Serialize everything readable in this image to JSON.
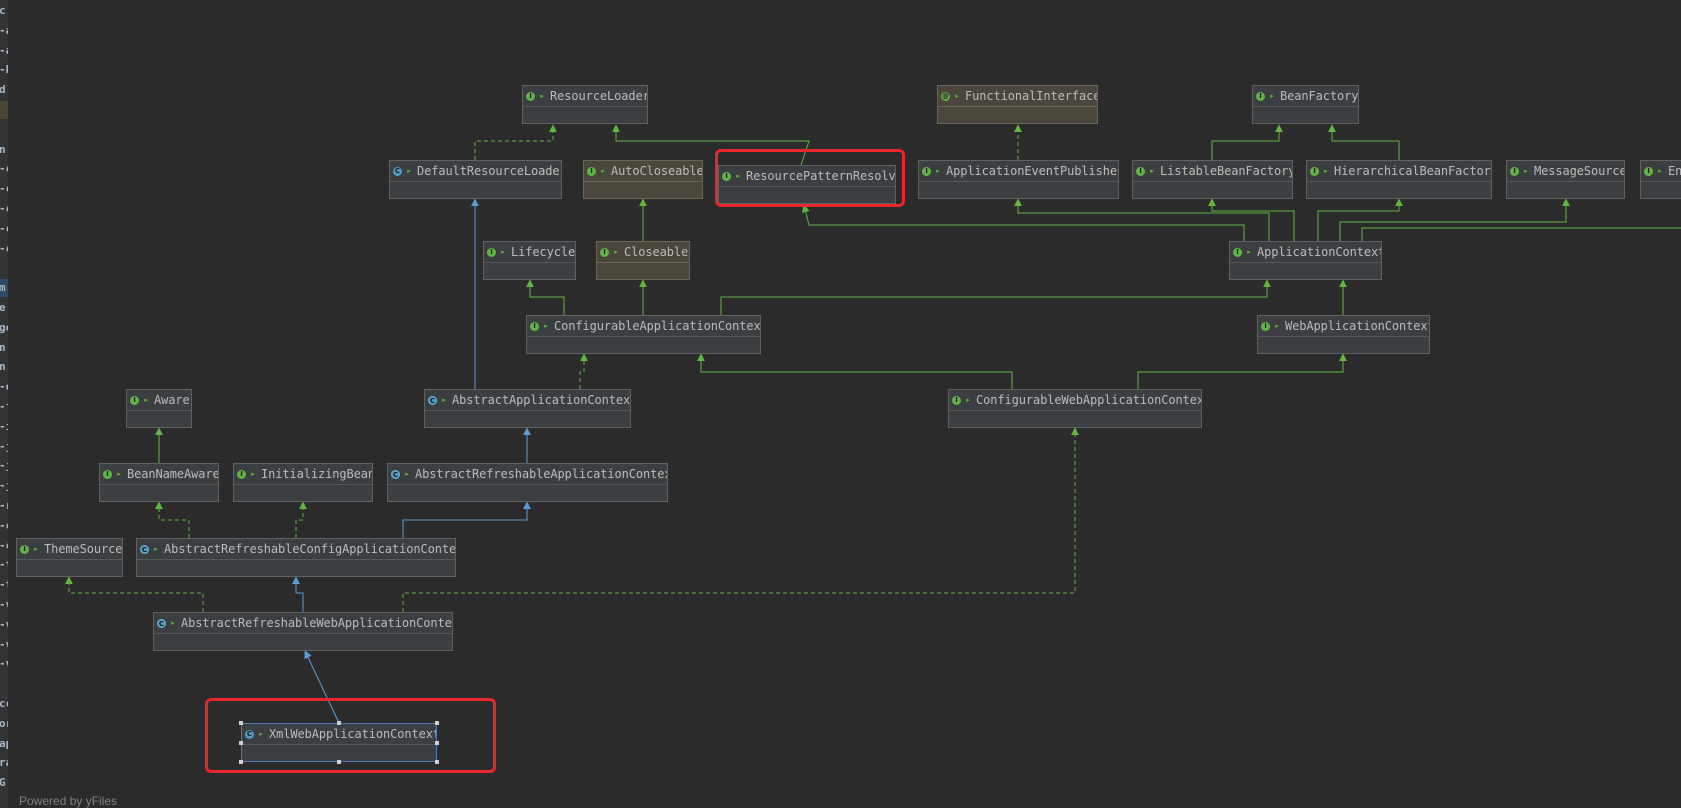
{
  "diagram": {
    "nodes": [
      {
        "id": "ResourceLoader",
        "label": "ResourceLoader",
        "kind": "interface"
      },
      {
        "id": "FunctionalInterface",
        "label": "FunctionalInterface",
        "kind": "annotation"
      },
      {
        "id": "BeanFactory",
        "label": "BeanFactory",
        "kind": "interface"
      },
      {
        "id": "DefaultResourceLoader",
        "label": "DefaultResourceLoader",
        "kind": "class"
      },
      {
        "id": "AutoCloseable",
        "label": "AutoCloseable",
        "kind": "java-interface"
      },
      {
        "id": "ResourcePatternResolver",
        "label": "ResourcePatternResolver",
        "kind": "interface"
      },
      {
        "id": "ApplicationEventPublisher",
        "label": "ApplicationEventPublisher",
        "kind": "interface"
      },
      {
        "id": "ListableBeanFactory",
        "label": "ListableBeanFactory",
        "kind": "interface"
      },
      {
        "id": "HierarchicalBeanFactory",
        "label": "HierarchicalBeanFactory",
        "kind": "interface"
      },
      {
        "id": "MessageSource",
        "label": "MessageSource",
        "kind": "interface"
      },
      {
        "id": "EnvironmentCapable",
        "label": "EnvironmentCapable",
        "kind": "interface"
      },
      {
        "id": "Lifecycle",
        "label": "Lifecycle",
        "kind": "interface"
      },
      {
        "id": "Closeable",
        "label": "Closeable",
        "kind": "java-interface"
      },
      {
        "id": "ApplicationContext",
        "label": "ApplicationContext",
        "kind": "interface"
      },
      {
        "id": "ConfigurableApplicationContext",
        "label": "ConfigurableApplicationContext",
        "kind": "interface"
      },
      {
        "id": "WebApplicationContext",
        "label": "WebApplicationContext",
        "kind": "interface"
      },
      {
        "id": "Aware",
        "label": "Aware",
        "kind": "interface"
      },
      {
        "id": "AbstractApplicationContext",
        "label": "AbstractApplicationContext",
        "kind": "abstract"
      },
      {
        "id": "ConfigurableWebApplicationContext",
        "label": "ConfigurableWebApplicationContext",
        "kind": "interface"
      },
      {
        "id": "BeanNameAware",
        "label": "BeanNameAware",
        "kind": "interface"
      },
      {
        "id": "InitializingBean",
        "label": "InitializingBean",
        "kind": "interface"
      },
      {
        "id": "AbstractRefreshableApplicationContext",
        "label": "AbstractRefreshableApplicationContext",
        "kind": "abstract"
      },
      {
        "id": "ThemeSource",
        "label": "ThemeSource",
        "kind": "interface"
      },
      {
        "id": "AbstractRefreshableConfigApplicationContext",
        "label": "AbstractRefreshableConfigApplicationContext",
        "kind": "abstract"
      },
      {
        "id": "AbstractRefreshableWebApplicationContext",
        "label": "AbstractRefreshableWebApplicationContext",
        "kind": "abstract"
      },
      {
        "id": "XmlWebApplicationContext",
        "label": "XmlWebApplicationContext",
        "kind": "class",
        "selected": true
      }
    ],
    "edges": [
      {
        "from": "DefaultResourceLoader",
        "to": "ResourceLoader",
        "type": "implements"
      },
      {
        "from": "ResourcePatternResolver",
        "to": "ResourceLoader",
        "type": "extends"
      },
      {
        "from": "ApplicationEventPublisher",
        "to": "FunctionalInterface",
        "type": "annotated"
      },
      {
        "from": "ListableBeanFactory",
        "to": "BeanFactory",
        "type": "extends"
      },
      {
        "from": "HierarchicalBeanFactory",
        "to": "BeanFactory",
        "type": "extends"
      },
      {
        "from": "Closeable",
        "to": "AutoCloseable",
        "type": "extends"
      },
      {
        "from": "ApplicationContext",
        "to": "ResourcePatternResolver",
        "type": "extends"
      },
      {
        "from": "ApplicationContext",
        "to": "ApplicationEventPublisher",
        "type": "extends"
      },
      {
        "from": "ApplicationContext",
        "to": "ListableBeanFactory",
        "type": "extends"
      },
      {
        "from": "ApplicationContext",
        "to": "HierarchicalBeanFactory",
        "type": "extends"
      },
      {
        "from": "ApplicationContext",
        "to": "MessageSource",
        "type": "extends"
      },
      {
        "from": "ApplicationContext",
        "to": "EnvironmentCapable",
        "type": "extends"
      },
      {
        "from": "ConfigurableApplicationContext",
        "to": "Lifecycle",
        "type": "extends"
      },
      {
        "from": "ConfigurableApplicationContext",
        "to": "Closeable",
        "type": "extends"
      },
      {
        "from": "ConfigurableApplicationContext",
        "to": "ApplicationContext",
        "type": "extends"
      },
      {
        "from": "WebApplicationContext",
        "to": "ApplicationContext",
        "type": "extends"
      },
      {
        "from": "AbstractApplicationContext",
        "to": "DefaultResourceLoader",
        "type": "extends"
      },
      {
        "from": "AbstractApplicationContext",
        "to": "ConfigurableApplicationContext",
        "type": "implements"
      },
      {
        "from": "ConfigurableWebApplicationContext",
        "to": "ConfigurableApplicationContext",
        "type": "extends"
      },
      {
        "from": "ConfigurableWebApplicationContext",
        "to": "WebApplicationContext",
        "type": "extends"
      },
      {
        "from": "BeanNameAware",
        "to": "Aware",
        "type": "extends"
      },
      {
        "from": "AbstractRefreshableApplicationContext",
        "to": "AbstractApplicationContext",
        "type": "extends"
      },
      {
        "from": "AbstractRefreshableConfigApplicationContext",
        "to": "BeanNameAware",
        "type": "implements"
      },
      {
        "from": "AbstractRefreshableConfigApplicationContext",
        "to": "InitializingBean",
        "type": "implements"
      },
      {
        "from": "AbstractRefreshableConfigApplicationContext",
        "to": "AbstractRefreshableApplicationContext",
        "type": "extends"
      },
      {
        "from": "AbstractRefreshableWebApplicationContext",
        "to": "ThemeSource",
        "type": "implements"
      },
      {
        "from": "AbstractRefreshableWebApplicationContext",
        "to": "AbstractRefreshableConfigApplicationContext",
        "type": "extends"
      },
      {
        "from": "AbstractRefreshableWebApplicationContext",
        "to": "ConfigurableWebApplicationContext",
        "type": "implements"
      },
      {
        "from": "XmlWebApplicationContext",
        "to": "AbstractRefreshableWebApplicationContext",
        "type": "extends"
      }
    ],
    "highlighted": [
      "ResourcePatternResolver",
      "XmlWebApplicationContext"
    ]
  },
  "side_panel": {
    "letters": [
      "c",
      "-a",
      "-a",
      "-b",
      "d",
      "",
      "",
      "n",
      "-c",
      "-c",
      "-c",
      "-c",
      "-c",
      "",
      "m",
      "e",
      "ge",
      "n.",
      "n",
      "-e",
      "-f",
      "-i",
      "-j",
      "-j",
      "-j",
      "-r",
      "-c",
      "-c",
      "-t",
      "-t",
      "-v",
      "-v",
      "-v",
      "-v",
      "",
      "cc",
      "or",
      "ap",
      "ra",
      "G"
    ]
  },
  "footer": {
    "text": "Powered by yFiles"
  },
  "colors": {
    "background": "#2b2b2b",
    "interface_arrow": "#62b543",
    "class_arrow": "#5b9bd5",
    "highlight": "#e8272b"
  }
}
